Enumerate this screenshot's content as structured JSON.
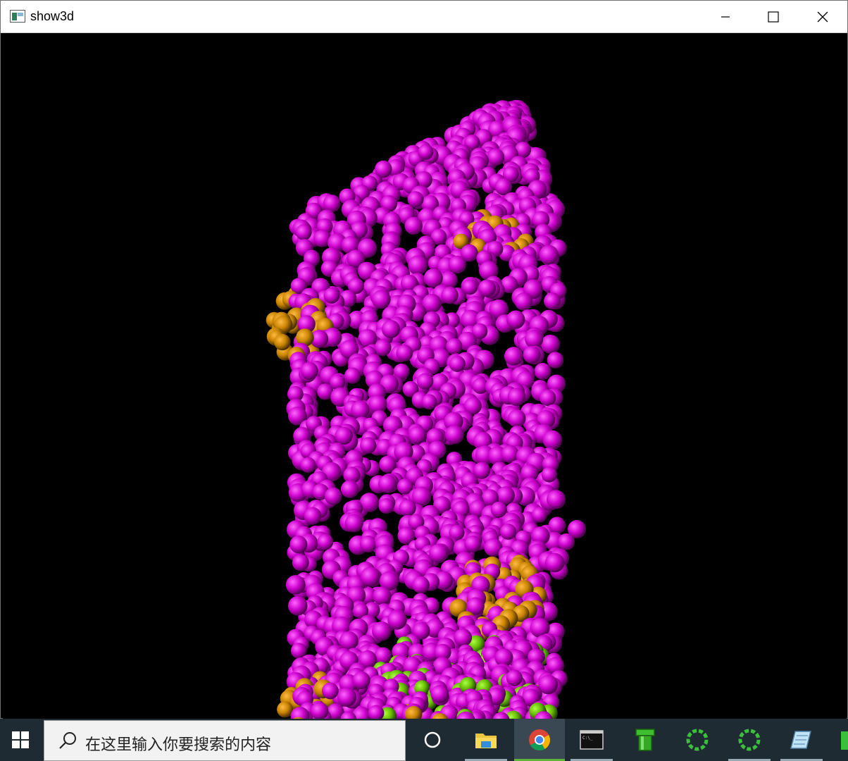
{
  "window": {
    "title": "show3d",
    "controls": {
      "minimize": "minimize-icon",
      "maximize": "maximize-icon",
      "close": "close-icon"
    }
  },
  "viewport": {
    "background": "#000000",
    "sphere_colors": {
      "magenta": "#cc00cc",
      "orange": "#cc8800",
      "green": "#66cc00"
    }
  },
  "taskbar": {
    "search_placeholder": "在这里输入你要搜索的内容",
    "items": [
      {
        "name": "cortana",
        "icon": "circle-icon"
      },
      {
        "name": "file-explorer",
        "icon": "folder-icon"
      },
      {
        "name": "chrome",
        "icon": "chrome-icon",
        "active": true
      },
      {
        "name": "command-prompt",
        "icon": "terminal-icon"
      },
      {
        "name": "green-pipe-app",
        "icon": "pipe-icon"
      },
      {
        "name": "spinner-app-1",
        "icon": "spinner-icon"
      },
      {
        "name": "spinner-app-2",
        "icon": "spinner-icon"
      },
      {
        "name": "notes-app",
        "icon": "notepad-icon"
      }
    ]
  }
}
